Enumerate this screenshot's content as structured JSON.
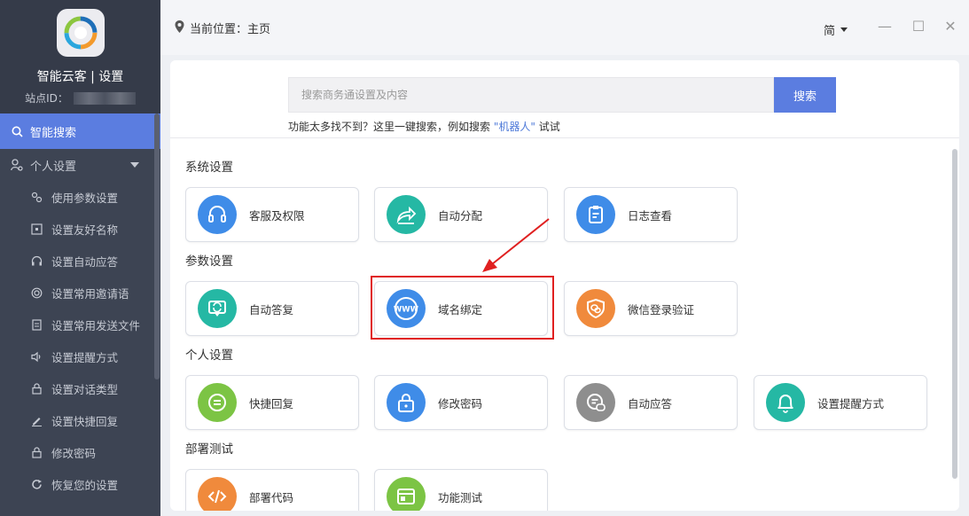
{
  "sidebar": {
    "app_title": "智能云客 | 设置",
    "site_id_label": "站点ID：",
    "active_item": "智能搜索",
    "group_label": "个人设置",
    "items": [
      {
        "label": "使用参数设置",
        "icon": "params-icon"
      },
      {
        "label": "设置友好名称",
        "icon": "name-icon"
      },
      {
        "label": "设置自动应答",
        "icon": "headset-icon"
      },
      {
        "label": "设置常用邀请语",
        "icon": "invite-icon"
      },
      {
        "label": "设置常用发送文件",
        "icon": "file-icon"
      },
      {
        "label": "设置提醒方式",
        "icon": "speaker-icon"
      },
      {
        "label": "设置对话类型",
        "icon": "lock-icon"
      },
      {
        "label": "设置快捷回复",
        "icon": "edit-icon"
      },
      {
        "label": "修改密码",
        "icon": "lock-icon"
      },
      {
        "label": "恢复您的设置",
        "icon": "refresh-icon"
      }
    ]
  },
  "topbar": {
    "location": "当前位置：主页",
    "lang": "简",
    "minimize": "—",
    "maximize": "☐",
    "close": "✕"
  },
  "search": {
    "placeholder": "搜索商务通设置及内容",
    "button": "搜索",
    "hint_prefix": "功能太多找不到？这里一键搜索，例如搜索",
    "hint_keyword": "\"机器人\"",
    "hint_suffix": "试试"
  },
  "sections": [
    {
      "title": "系统设置",
      "cards": [
        {
          "label": "客服及权限",
          "icon": "headset-icon",
          "color": "#3f8ce8"
        },
        {
          "label": "自动分配",
          "icon": "share-icon",
          "color": "#25b8a4"
        },
        {
          "label": "日志查看",
          "icon": "clipboard-icon",
          "color": "#3f8ce8"
        }
      ]
    },
    {
      "title": "参数设置",
      "cards": [
        {
          "label": "自动答复",
          "icon": "auto-reply-icon",
          "color": "#25b8a4"
        },
        {
          "label": "域名绑定",
          "icon": "www-icon",
          "color": "#3f8ce8"
        },
        {
          "label": "微信登录验证",
          "icon": "wechat-shield-icon",
          "color": "#f08a3c"
        }
      ]
    },
    {
      "title": "个人设置",
      "cards": [
        {
          "label": "快捷回复",
          "icon": "chat-icon",
          "color": "#7cc444"
        },
        {
          "label": "修改密码",
          "icon": "lock-icon",
          "color": "#3f8ce8"
        },
        {
          "label": "自动应答",
          "icon": "auto-answer-icon",
          "color": "#8e8e8e"
        },
        {
          "label": "设置提醒方式",
          "icon": "bell-icon",
          "color": "#25b8a4"
        }
      ]
    },
    {
      "title": "部署测试",
      "cards": [
        {
          "label": "部署代码",
          "icon": "code-icon",
          "color": "#f08a3c"
        },
        {
          "label": "功能测试",
          "icon": "test-icon",
          "color": "#7cc444"
        }
      ]
    }
  ],
  "colors": {
    "accent": "#5b7de0",
    "sidebar_bg": "#3d4453",
    "highlight": "#e02020"
  }
}
